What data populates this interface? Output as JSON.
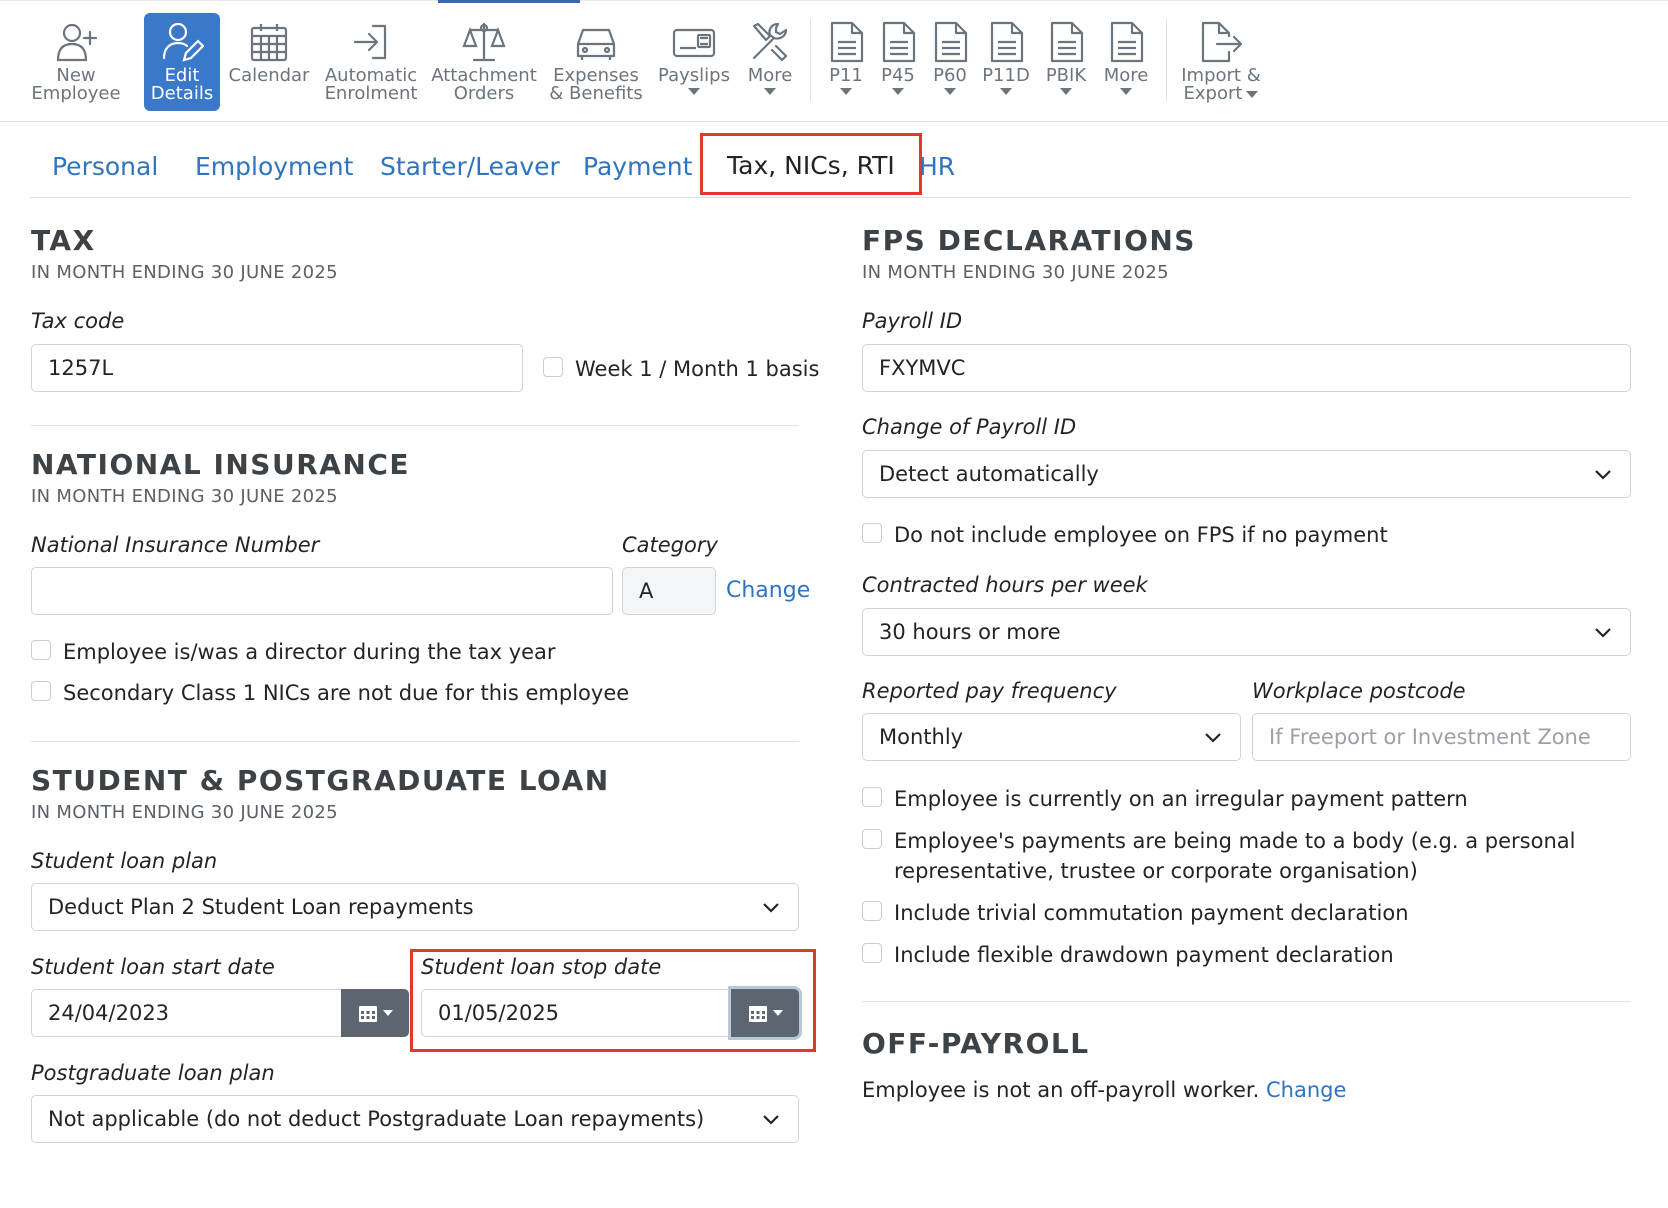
{
  "toolbar": {
    "buttons": [
      {
        "line1": "New",
        "line2": "Employee",
        "icon": "add-user-icon"
      },
      {
        "line1": "Edit",
        "line2": "Details",
        "icon": "edit-user-icon",
        "active": true
      },
      {
        "line1": "Calendar",
        "line2": "",
        "icon": "calendar-icon"
      },
      {
        "line1": "Automatic",
        "line2": "Enrolment",
        "icon": "sign-in-icon"
      },
      {
        "line1": "Attachment",
        "line2": "Orders",
        "icon": "scales-icon"
      },
      {
        "line1": "Expenses",
        "line2": "& Benefits",
        "icon": "car-icon"
      },
      {
        "line1": "Payslips",
        "line2": "",
        "icon": "payslip-icon"
      },
      {
        "line1": "More",
        "line2": "",
        "icon": "tools-icon"
      },
      {
        "line1": "P11",
        "line2": "",
        "icon": "document-icon"
      },
      {
        "line1": "P45",
        "line2": "",
        "icon": "document-icon"
      },
      {
        "line1": "P60",
        "line2": "",
        "icon": "document-icon"
      },
      {
        "line1": "P11D",
        "line2": "",
        "icon": "document-icon"
      },
      {
        "line1": "PBIK",
        "line2": "",
        "icon": "document-icon"
      },
      {
        "line1": "More",
        "line2": "",
        "icon": "document-icon"
      },
      {
        "line1": "Import &",
        "line2": "Export",
        "icon": "export-icon"
      }
    ]
  },
  "tabs": [
    "Personal",
    "Employment",
    "Starter/Leaver",
    "Payment",
    "Tax, NICs, RTI",
    "HR"
  ],
  "active_tab": "Tax, NICs, RTI",
  "tax": {
    "heading": "TAX",
    "period": "IN MONTH ENDING 30 JUNE 2025",
    "tax_code_label": "Tax code",
    "tax_code_value": "1257L",
    "week1_label": "Week 1 / Month 1 basis"
  },
  "ni": {
    "heading": "NATIONAL INSURANCE",
    "period": "IN MONTH ENDING 30 JUNE 2025",
    "number_label": "National Insurance Number",
    "number_value": "",
    "category_label": "Category",
    "category_value": "A",
    "change_link": "Change",
    "director_label": "Employee is/was a director during the tax year",
    "secondary_label": "Secondary Class 1 NICs are not due for this employee"
  },
  "loan": {
    "heading": "STUDENT & POSTGRADUATE LOAN",
    "period": "IN MONTH ENDING 30 JUNE 2025",
    "plan_label": "Student loan plan",
    "plan_value": "Deduct Plan 2 Student Loan repayments",
    "start_label": "Student loan start date",
    "start_value": "24/04/2023",
    "stop_label": "Student loan stop date",
    "stop_value": "01/05/2025",
    "pg_label": "Postgraduate loan plan",
    "pg_value": "Not applicable (do not deduct Postgraduate Loan repayments)"
  },
  "fps": {
    "heading": "FPS DECLARATIONS",
    "period": "IN MONTH ENDING 30 JUNE 2025",
    "payroll_id_label": "Payroll ID",
    "payroll_id_value": "FXYMVC",
    "change_payroll_label": "Change of Payroll ID",
    "change_payroll_value": "Detect automatically",
    "no_payment_label": "Do not include employee on FPS if no payment",
    "hours_label": "Contracted hours per week",
    "hours_value": "30 hours or more",
    "frequency_label": "Reported pay frequency",
    "frequency_value": "Monthly",
    "postcode_label": "Workplace postcode",
    "postcode_placeholder": "If Freeport or Investment Zone",
    "irregular_label": "Employee is currently on an irregular payment pattern",
    "body_label_line1": "Employee's payments are being made to a body (e.g. a personal",
    "body_label_line2": "representative, trustee or corporate organisation)",
    "trivial_label": "Include trivial commutation payment declaration",
    "flexible_label": "Include flexible drawdown payment declaration"
  },
  "off_payroll": {
    "heading": "OFF-PAYROLL",
    "text": "Employee is not an off-payroll worker.",
    "change_link": "Change"
  },
  "colors": {
    "accent": "#3a78c9",
    "link": "#2f74c0",
    "highlight": "#e0382e",
    "calendar_button": "#5d6670"
  }
}
